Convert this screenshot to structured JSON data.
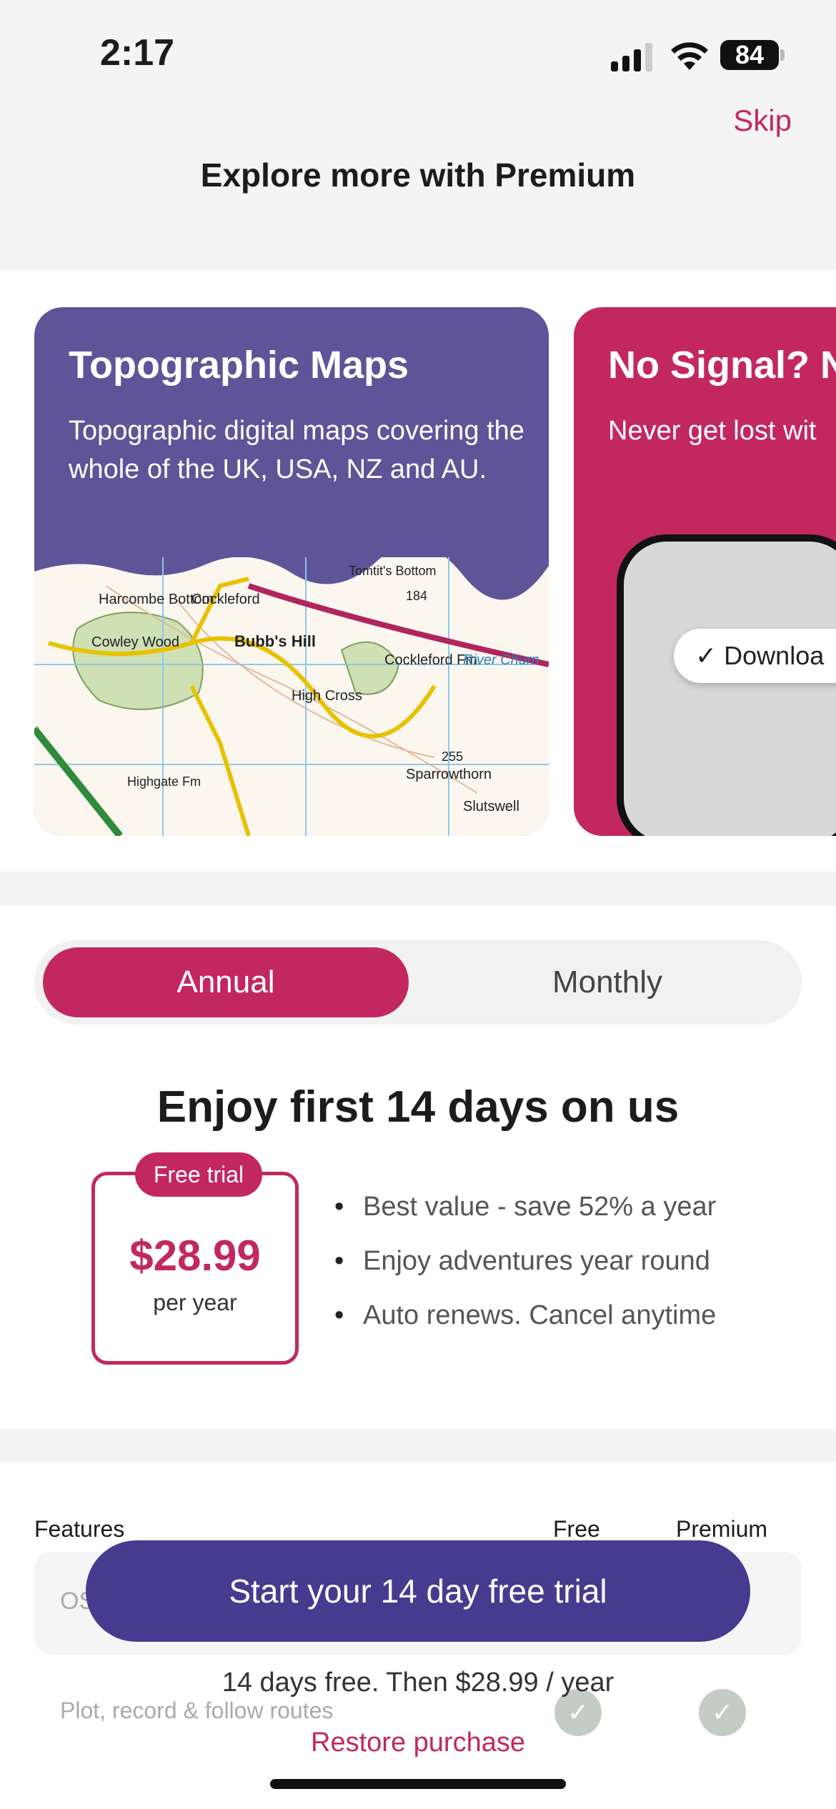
{
  "status": {
    "time": "2:17",
    "battery": "84"
  },
  "header": {
    "skip": "Skip",
    "title": "Explore more with Premium"
  },
  "carousel": {
    "cards": [
      {
        "title": "Topographic Maps",
        "text": "Topographic digital maps covering the whole of the UK, USA, NZ and AU."
      },
      {
        "title": "No Signal? N",
        "text": "Never get lost wit",
        "pill": "✓ Downloa"
      }
    ],
    "map_labels": [
      "Harcombe Bottom",
      "Cockleford",
      "Tomtit's Bottom",
      "Cowley Wood",
      "Bubb's Hill",
      "Cockleford Fm",
      "River Churn",
      "High Cross",
      "255",
      "Sparrowthorn",
      "Highgate Fm",
      "Slutswell",
      "184"
    ],
    "colors": {
      "card1": "#5f5498",
      "card2": "#c2285f"
    }
  },
  "pricing": {
    "toggle": {
      "annual": "Annual",
      "monthly": "Monthly",
      "selected": "Annual"
    },
    "headline": "Enjoy first 14 days on us",
    "badge": "Free trial",
    "price": "$28.99",
    "per": "per year",
    "bullets": [
      "Best value - save 52% a year",
      "Enjoy adventures year round",
      "Auto renews. Cancel anytime"
    ]
  },
  "features": {
    "headers": {
      "features": "Features",
      "free": "Free",
      "premium": "Premium"
    },
    "rows": [
      {
        "label": "OS"
      },
      {
        "label": "Plot, record & follow routes"
      }
    ]
  },
  "cta": {
    "button": "Start your 14 day free trial",
    "fine_print": "14 days free. Then $28.99 / year",
    "restore": "Restore purchase"
  },
  "theme": {
    "accent": "#c2285f",
    "primary": "#463b8f"
  }
}
